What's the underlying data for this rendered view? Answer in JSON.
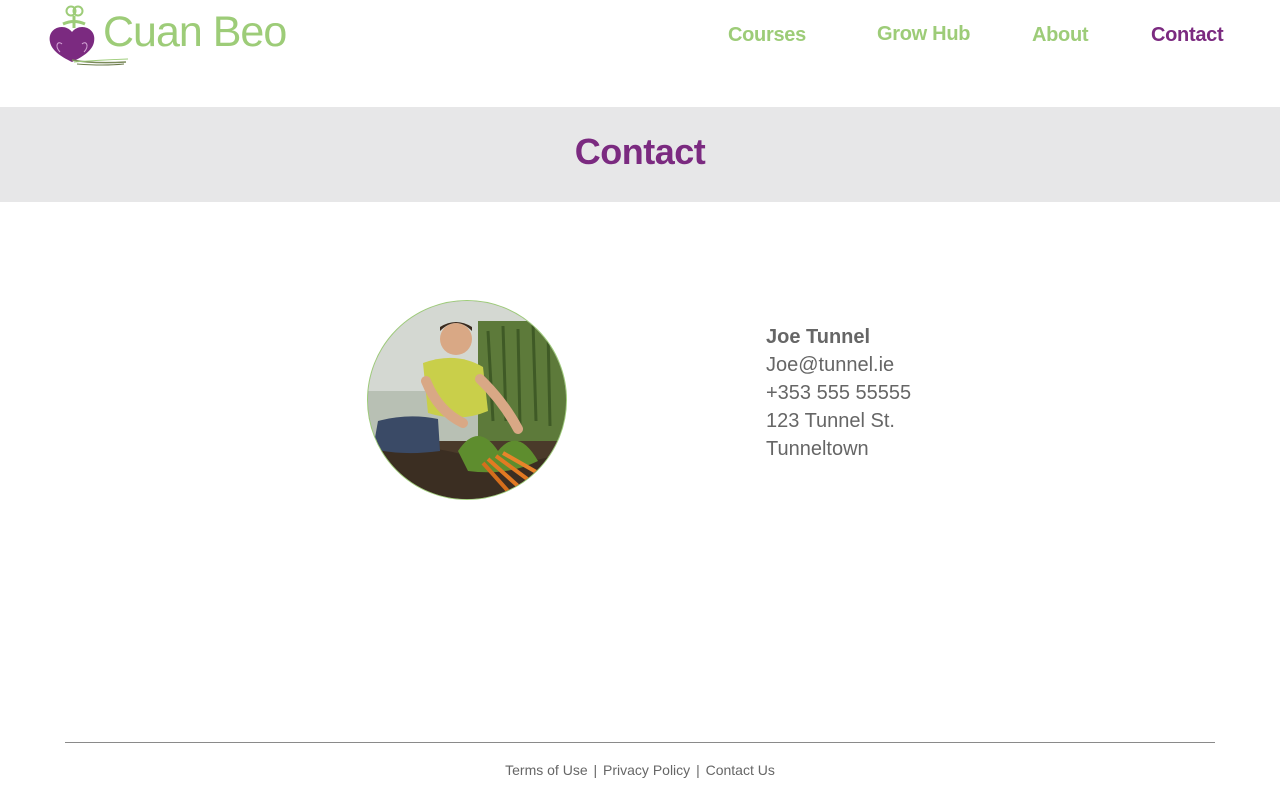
{
  "brand": {
    "name": "Cuan Beo",
    "accent_green": "#9dcc78",
    "accent_purple": "#7b2a80"
  },
  "nav": {
    "items": [
      {
        "label": "Courses",
        "active": false
      },
      {
        "label": "Grow Hub",
        "active": false
      },
      {
        "label": "About",
        "active": false
      },
      {
        "label": "Contact",
        "active": true
      }
    ]
  },
  "page": {
    "title": "Contact"
  },
  "contact": {
    "photo_icon": "person-photo",
    "name": "Joe Tunnel",
    "email": "Joe@tunnel.ie",
    "phone": "+353 555 55555",
    "address_line1": "123 Tunnel St.",
    "address_line2": "Tunneltown"
  },
  "footer": {
    "links": [
      {
        "label": "Terms of Use"
      },
      {
        "label": "Privacy Policy"
      },
      {
        "label": "Contact Us"
      }
    ],
    "separator": "|"
  }
}
